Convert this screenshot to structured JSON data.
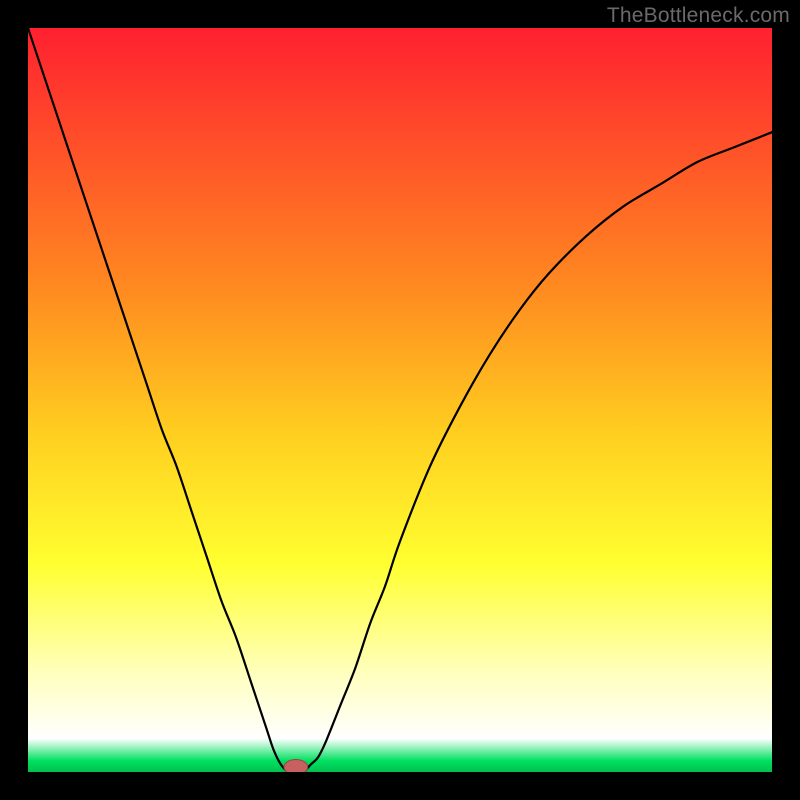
{
  "watermark": "TheBottleneck.com",
  "colors": {
    "frame": "#000000",
    "gradient_top": "#ff2030",
    "gradient_mid1": "#ff8a20",
    "gradient_mid2": "#ffd020",
    "gradient_mid3": "#ffff30",
    "gradient_pale": "#ffffc0",
    "gradient_green": "#00e060",
    "curve": "#000000",
    "marker_fill": "#c76060",
    "marker_stroke": "#a04040"
  },
  "chart_data": {
    "type": "line",
    "title": "",
    "xlabel": "",
    "ylabel": "",
    "xlim": [
      0,
      100
    ],
    "ylim": [
      0,
      100
    ],
    "series": [
      {
        "name": "bottleneck-curve",
        "x": [
          0,
          2,
          4,
          6,
          8,
          10,
          12,
          14,
          16,
          18,
          20,
          22,
          24,
          26,
          28,
          30,
          32,
          33,
          34,
          35,
          36,
          37,
          38,
          39,
          40,
          42,
          44,
          46,
          48,
          50,
          54,
          58,
          62,
          66,
          70,
          75,
          80,
          85,
          90,
          95,
          100
        ],
        "y": [
          100,
          94,
          88,
          82,
          76,
          70,
          64,
          58,
          52,
          46,
          41,
          35,
          29,
          23,
          18,
          12,
          6,
          3,
          1,
          0,
          0,
          0,
          1,
          2,
          4,
          9,
          14,
          20,
          25,
          31,
          41,
          49,
          56,
          62,
          67,
          72,
          76,
          79,
          82,
          84,
          86
        ]
      }
    ],
    "marker": {
      "x": 36,
      "y": 0,
      "rx": 1.6,
      "ry": 1.0
    },
    "gradient_stops": [
      {
        "pos": 0.0,
        "value": 100
      },
      {
        "pos": 0.35,
        "value": 65
      },
      {
        "pos": 0.55,
        "value": 45
      },
      {
        "pos": 0.72,
        "value": 28
      },
      {
        "pos": 0.87,
        "value": 13
      },
      {
        "pos": 0.955,
        "value": 4.5
      },
      {
        "pos": 0.985,
        "value": 1.5
      },
      {
        "pos": 1.0,
        "value": 0
      }
    ]
  }
}
